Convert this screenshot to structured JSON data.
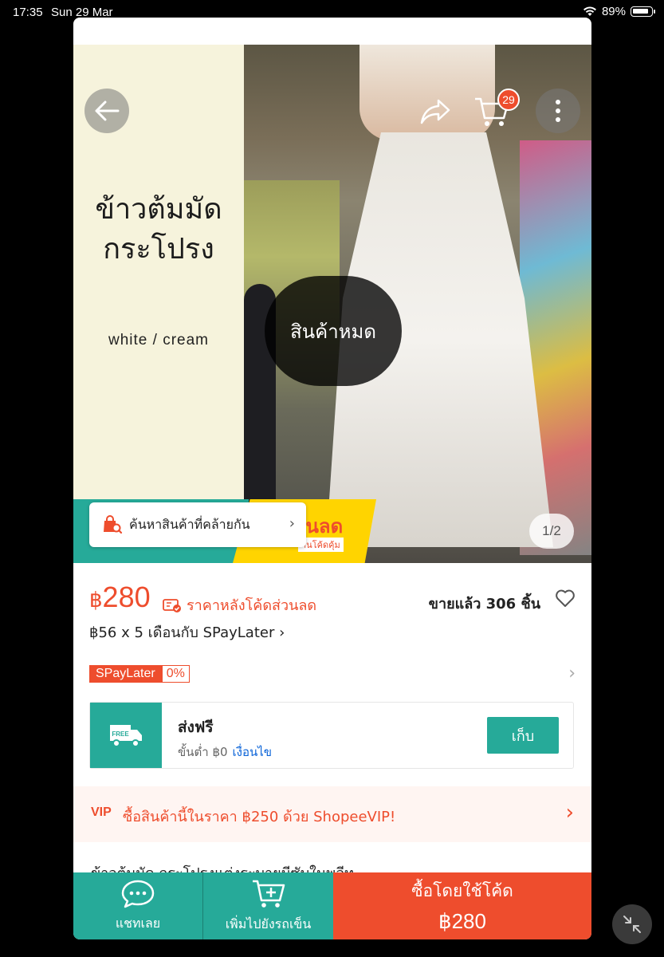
{
  "status_bar": {
    "time": "17:35",
    "date": "Sun 29 Mar",
    "battery": "89%"
  },
  "hero": {
    "title_line1": "ข้าวต้มมัด",
    "title_line2": "กระโปรง",
    "subtitle": "white / cream",
    "overlay_status": "สินค้าหมด",
    "cart_count": "29",
    "page_indicator": "1/2",
    "promo_text": "วนลด",
    "promo_small": "านโค้ดคุ้ม",
    "similar_button": "ค้นหาสินค้าที่คล้ายกัน"
  },
  "price": {
    "currency": "฿",
    "amount": "280",
    "note": "ราคาหลังโค้ดส่วนลด",
    "sold": "ขายแล้ว 306 ชิ้น",
    "installment": "฿56 x 5 เดือนกับ SPayLater"
  },
  "spaylater": {
    "label": "SPayLater",
    "rate": "0%"
  },
  "voucher": {
    "badge": "FREE",
    "title": "ส่งฟรี",
    "min_spend": "ขั้นต่ำ ฿0",
    "conditions": "เงื่อนไข",
    "collect": "เก็บ"
  },
  "vip": {
    "icon": "VIP",
    "text": "ซื้อสินค้านี้ในราคา ฿250 ด้วย ShopeeVIP!"
  },
  "description_peek": "ข้าวต้มมัด กระโปรงแต่งระบายมีซับในพลีท",
  "bottom_bar": {
    "chat": "แชทเลย",
    "add_to_cart": "เพิ่มไปยังรถเข็น",
    "buy_with_code": "ซื้อโดยใช้โค้ด",
    "buy_price": "฿280"
  },
  "colors": {
    "brand": "#ee4d2d",
    "teal": "#26aa99",
    "link": "#0a63d8"
  }
}
